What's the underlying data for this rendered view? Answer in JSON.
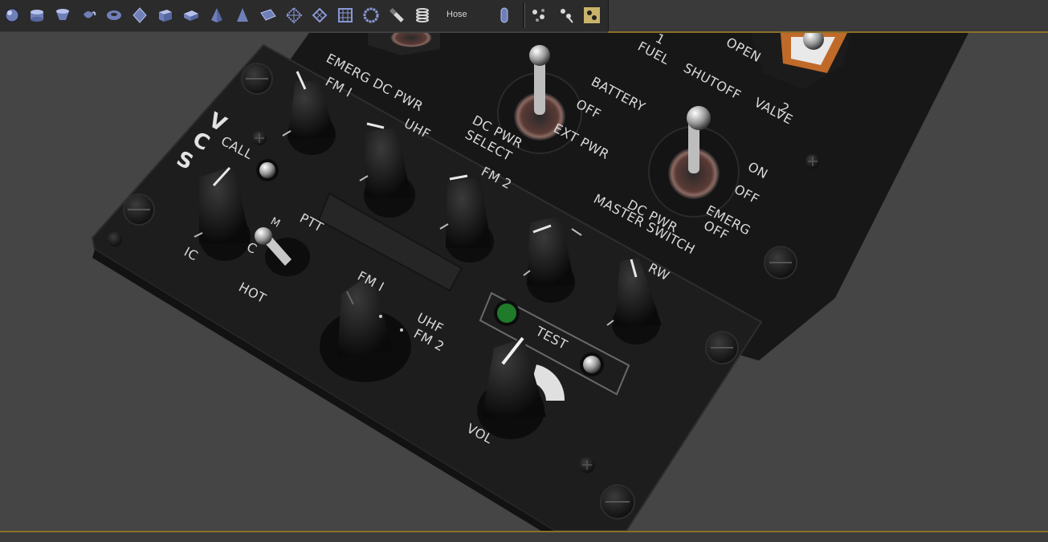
{
  "toolbar": {
    "label": "Hose",
    "icons": [
      "sphere-icon",
      "cylinder-icon",
      "cone-icon",
      "teapot-icon",
      "torus-icon",
      "geosphere-icon",
      "box-icon",
      "chamfer-box-icon",
      "pyramid-icon",
      "tetra-cone-icon",
      "plane-icon",
      "grid-plane-icon",
      "diamond-grid-icon",
      "grid-icon",
      "ring-icon",
      "tube-tool-icon",
      "spring-icon",
      "capsule-icon",
      "particle-icon",
      "particle-spray-icon",
      "particle-select-icon"
    ]
  },
  "panel": {
    "upper": {
      "emerg_dc_pwr": "EMERG DC PWR",
      "battery": "BATTERY",
      "off1": "OFF",
      "ext_pwr": "EXT PWR",
      "dc_pwr_select_1": "DC PWR",
      "dc_pwr_select_2": "SELECT",
      "fuel_1": "1",
      "fuel_2": "FUEL",
      "shutoff": "SHUTOFF",
      "valve_num": "2",
      "valve": "VALVE",
      "open": "OPEN",
      "on": "ON",
      "off2": "OFF",
      "emerg": "EMERG",
      "off3": "OFF",
      "dc_pwr_master_1": "DC PWR",
      "dc_pwr_master_2": "MASTER SWITCH"
    },
    "vcs": {
      "v": "V",
      "c": "C",
      "s": "S",
      "call": "CALL",
      "fm1": "FM I",
      "uhf": "UHF",
      "fm2": "FM 2",
      "ptt": "PTT",
      "m": "M",
      "c_pos": "C",
      "ic": "IC",
      "hot": "HOT",
      "rw": "RW",
      "fm1_sel": "FM I",
      "uhf_sel": "UHF",
      "fm2_sel": "FM 2",
      "test": "TEST",
      "vol": "VOL"
    }
  },
  "colors": {
    "accent": "#8a6f2a",
    "indicator_green": "#1f7a2a",
    "panel": "#1c1c1c"
  }
}
